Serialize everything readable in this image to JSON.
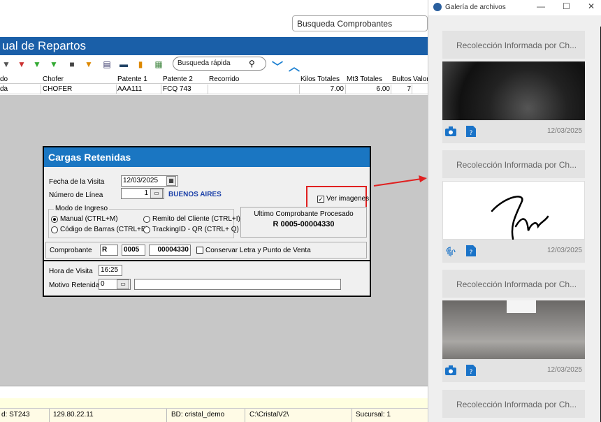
{
  "top_search": {
    "placeholder": "Busqueda Comprobantes"
  },
  "window": {
    "title": "ual de Repartos"
  },
  "toolbar": {
    "quick_search_placeholder": "Busqueda rápida"
  },
  "grid": {
    "columns": [
      "do",
      "Chofer",
      "Patente 1",
      "Patente 2",
      "Recorrido",
      "Kilos Totales",
      "Mt3 Totales",
      "Bultos",
      "Valor"
    ],
    "row": {
      "c0": "da",
      "chofer": "CHOFER",
      "patente1": "AAA111",
      "patente2": "FCQ 743",
      "recorrido": "",
      "kilos": "7.00",
      "mt3": "6.00",
      "bultos": "7",
      "valor": ""
    }
  },
  "dialog": {
    "title": "Cargas Retenidas",
    "fecha_label": "Fecha de la Visita",
    "fecha_value": "12/03/2025",
    "linea_label": "Número de Línea",
    "linea_value": "1",
    "linea_name": "BUENOS AIRES",
    "ver_imagenes_label": "Ver imagenes",
    "ver_imagenes_checked": true,
    "modo_legend": "Modo de Ingreso",
    "modo_options": {
      "manual": "Manual (CTRL+M)",
      "remito": "Remito del Cliente (CTRL+I)",
      "barras": "Código de Barras (CTRL+B)",
      "tracking": "TrackingID - QR (CTRL+ Q)"
    },
    "modo_selected": "manual",
    "ultimo_label": "Ultimo Comprobante Procesado",
    "ultimo_value": "R 0005-00004330",
    "comprobante_label": "Comprobante",
    "comprobante_letra": "R",
    "comprobante_pv": "0005",
    "comprobante_num": "00004330",
    "conservar_label": "Conservar Letra y Punto de Venta",
    "hora_label": "Hora de Visita",
    "hora_value": "16:25",
    "motivo_label": "Motivo Retenida",
    "motivo_value": "0",
    "motivo_desc": ""
  },
  "status_bar": {
    "id": "d: ST243",
    "ip": "129.80.22.11",
    "bd": "BD: cristal_demo",
    "path": "C:\\CristalV2\\",
    "sucursal": "Sucursal: 1"
  },
  "gallery": {
    "title": "Galería de archivos",
    "cards": [
      {
        "header": "Recolección Informada por Ch...",
        "date": "12/03/2025",
        "icon1": "camera-icon",
        "icon2": "document-icon"
      },
      {
        "header": "Recolección Informada por Ch...",
        "date": "12/03/2025",
        "icon1": "fingerprint-icon",
        "icon2": "document-icon"
      },
      {
        "header": "Recolección Informada por Ch...",
        "date": "12/03/2025",
        "icon1": "camera-icon",
        "icon2": "document-icon"
      },
      {
        "header": "Recolección Informada por Ch...",
        "date": "",
        "icon1": "",
        "icon2": ""
      }
    ]
  },
  "colors": {
    "title_blue": "#1a5fa8",
    "dialog_blue": "#1a76c2",
    "highlight_red": "#e02020",
    "gallery_bg": "#efefef"
  }
}
